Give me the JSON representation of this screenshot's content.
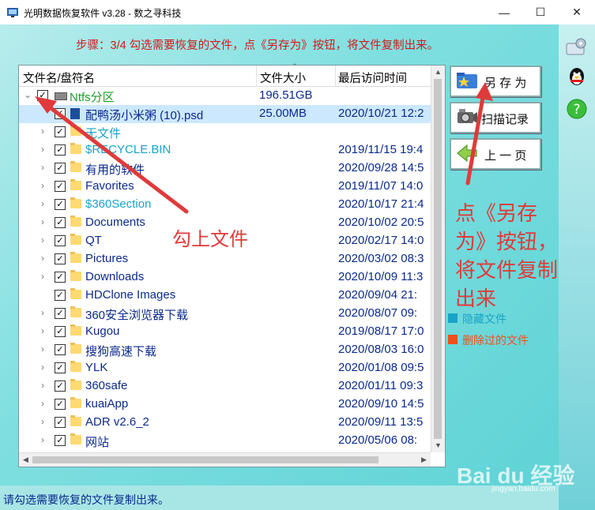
{
  "window": {
    "title": "光明数据恢复软件 v3.28 - 数之寻科技",
    "minimize": "—",
    "maximize": "☐",
    "close": "✕"
  },
  "step_text": "步骤：3/4 勾选需要恢复的文件，点《另存为》按钮，将文件复制出来。",
  "columns": {
    "name": "文件名/盘符名",
    "size": "文件大小",
    "time": "最后访问时间"
  },
  "rows": [
    {
      "name": "Ntfs分区",
      "size": "196.51GB",
      "date": "",
      "level": 0,
      "kind": "drive",
      "color": "green",
      "expander": "⌄"
    },
    {
      "name": "配鸭汤小米粥 (10).psd",
      "size": "25.00MB",
      "date": "2020/10/21 12:2",
      "level": 1,
      "kind": "file",
      "color": "blue",
      "expander": ""
    },
    {
      "name": "无文件",
      "size": "",
      "date": "",
      "level": 1,
      "kind": "folder",
      "color": "teal",
      "expander": "›"
    },
    {
      "name": "$RECYCLE.BIN",
      "size": "",
      "date": "2019/11/15 19:4",
      "level": 1,
      "kind": "folder",
      "color": "teal",
      "expander": "›"
    },
    {
      "name": "有用的软件",
      "size": "",
      "date": "2020/09/28 14:5",
      "level": 1,
      "kind": "folder",
      "color": "blue",
      "expander": "›"
    },
    {
      "name": "Favorites",
      "size": "",
      "date": "2019/11/07 14:0",
      "level": 1,
      "kind": "folder",
      "color": "blue",
      "expander": "›"
    },
    {
      "name": "$360Section",
      "size": "",
      "date": "2020/10/17 21:4",
      "level": 1,
      "kind": "folder",
      "color": "teal",
      "expander": "›"
    },
    {
      "name": "Documents",
      "size": "",
      "date": "2020/10/02 20:5",
      "level": 1,
      "kind": "folder",
      "color": "blue",
      "expander": "›"
    },
    {
      "name": "QT",
      "size": "",
      "date": "2020/02/17 14:0",
      "level": 1,
      "kind": "folder",
      "color": "blue",
      "expander": "›"
    },
    {
      "name": "Pictures",
      "size": "",
      "date": "2020/03/02 08:3",
      "level": 1,
      "kind": "folder",
      "color": "blue",
      "expander": "›"
    },
    {
      "name": "Downloads",
      "size": "",
      "date": "2020/10/09 11:3",
      "level": 1,
      "kind": "folder",
      "color": "blue",
      "expander": "›"
    },
    {
      "name": "HDClone Images",
      "size": "",
      "date": "2020/09/04 21:",
      "level": 1,
      "kind": "folder",
      "color": "blue",
      "expander": ""
    },
    {
      "name": "360安全浏览器下载",
      "size": "",
      "date": "2020/08/07 09:",
      "level": 1,
      "kind": "folder",
      "color": "blue",
      "expander": "›"
    },
    {
      "name": "Kugou",
      "size": "",
      "date": "2019/08/17 17:0",
      "level": 1,
      "kind": "folder",
      "color": "blue",
      "expander": "›"
    },
    {
      "name": "搜狗高速下载",
      "size": "",
      "date": "2020/08/03 16:0",
      "level": 1,
      "kind": "folder",
      "color": "blue",
      "expander": "›"
    },
    {
      "name": "YLK",
      "size": "",
      "date": "2020/01/08 09:5",
      "level": 1,
      "kind": "folder",
      "color": "blue",
      "expander": "›"
    },
    {
      "name": "360safe",
      "size": "",
      "date": "2020/01/11 09:3",
      "level": 1,
      "kind": "folder",
      "color": "blue",
      "expander": "›"
    },
    {
      "name": "kuaiApp",
      "size": "",
      "date": "2020/09/10 14:5",
      "level": 1,
      "kind": "folder",
      "color": "blue",
      "expander": "›"
    },
    {
      "name": "ADR v2.6_2",
      "size": "",
      "date": "2020/09/11 13:5",
      "level": 1,
      "kind": "folder",
      "color": "blue",
      "expander": "›"
    },
    {
      "name": "网站",
      "size": "",
      "date": "2020/05/06 08:",
      "level": 1,
      "kind": "folder",
      "color": "blue",
      "expander": "›"
    }
  ],
  "buttons": {
    "save_as": "另 存 为",
    "scan_record": "扫描记录",
    "prev_page": "上 一 页"
  },
  "legend": [
    {
      "label": "隐藏文件",
      "color": "#1aa3c8"
    },
    {
      "label": "删除过的文件",
      "color": "#f0501a"
    }
  ],
  "annotations": {
    "check_files": "勾上文件",
    "click_save": "点《另存为》按钮，将文件复制出来"
  },
  "status": "请勾选需要恢复的文件复制出来。",
  "watermark": {
    "logo": "Bai du 经验",
    "url": "jingyan.baidu.com"
  }
}
